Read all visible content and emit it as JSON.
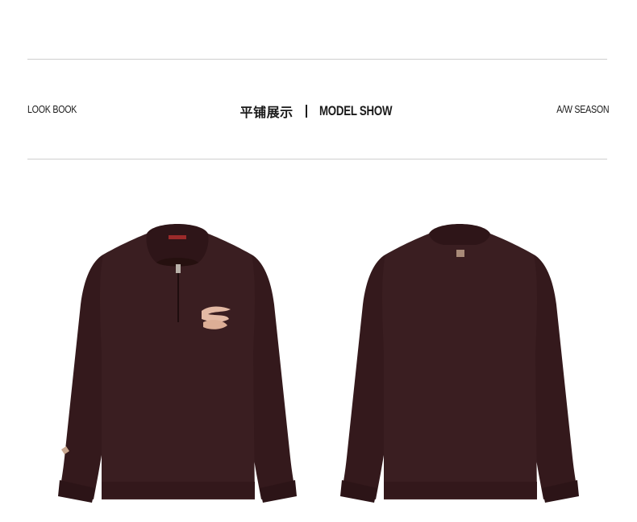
{
  "header": {
    "left_label": "LOOK BOOK",
    "title_cn": "平铺展示",
    "title_en": "MODEL SHOW",
    "right_label": "A/W SEASON"
  },
  "products": [
    {
      "view": "front",
      "color": "#3a1e21",
      "embroidery_text": ""
    },
    {
      "view": "back",
      "color": "#3a1e21"
    }
  ]
}
